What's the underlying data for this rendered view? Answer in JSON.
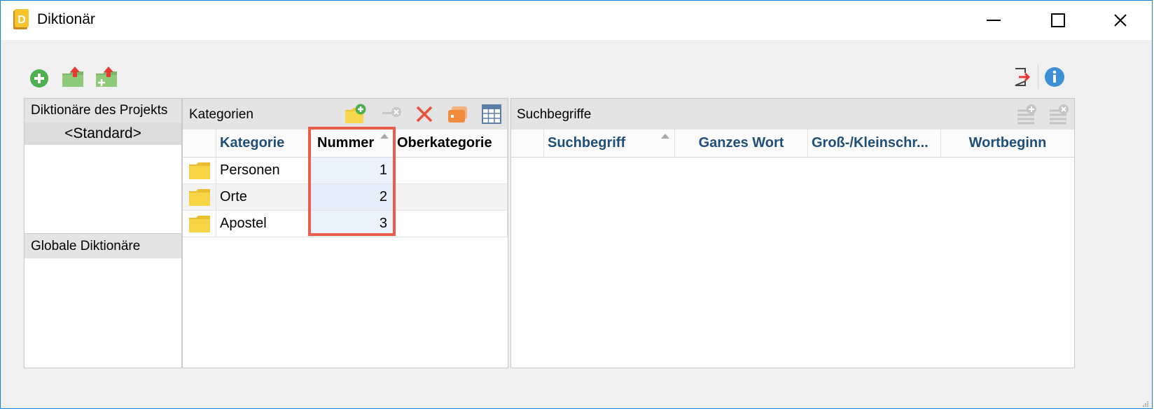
{
  "window": {
    "title": "Diktionär",
    "app_icon_letter": "D"
  },
  "left_panel": {
    "project_header": "Diktionäre des Projekts",
    "project_items": [
      "<Standard>"
    ],
    "global_header": "Globale Diktionäre"
  },
  "categories": {
    "header": "Kategorien",
    "columns": {
      "category": "Kategorie",
      "number": "Nummer",
      "parent": "Oberkategorie"
    },
    "rows": [
      {
        "name": "Personen",
        "number": "1",
        "parent": ""
      },
      {
        "name": "Orte",
        "number": "2",
        "parent": ""
      },
      {
        "name": "Apostel",
        "number": "3",
        "parent": ""
      }
    ]
  },
  "search_terms": {
    "header": "Suchbegriffe",
    "columns": {
      "term": "Suchbegriff",
      "whole_word": "Ganzes Wort",
      "case": "Groß-/Kleinschr...",
      "word_start": "Wortbeginn"
    }
  },
  "colors": {
    "accent_border": "#1783d6",
    "highlight": "#e85e4a",
    "column_text": "#1f4e79",
    "folder": "#f5d445"
  }
}
